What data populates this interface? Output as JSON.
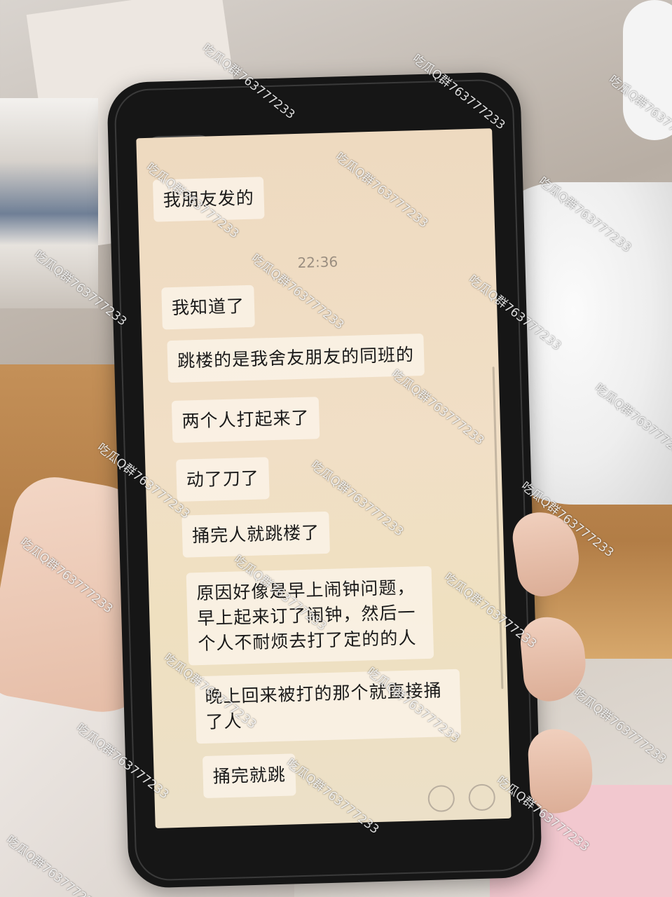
{
  "chat": {
    "messages": [
      "我朋友发的",
      "我知道了",
      "跳楼的是我舍友朋友的同班的",
      "两个人打起来了",
      "动了刀了",
      "捅完人就跳楼了",
      "原因好像是早上闹钟问题，早上起来订了闹钟，然后一个人不耐烦去打了定的的人",
      "晚上回来被打的那个就直接捅了人",
      "捅完就跳"
    ],
    "timestamp": "22:36"
  },
  "watermark": "吃瓜Q群763777233",
  "colors": {
    "screen_bg": "#eedac0",
    "bubble_bg": "#fcf6ec",
    "phone_body": "#161616"
  }
}
